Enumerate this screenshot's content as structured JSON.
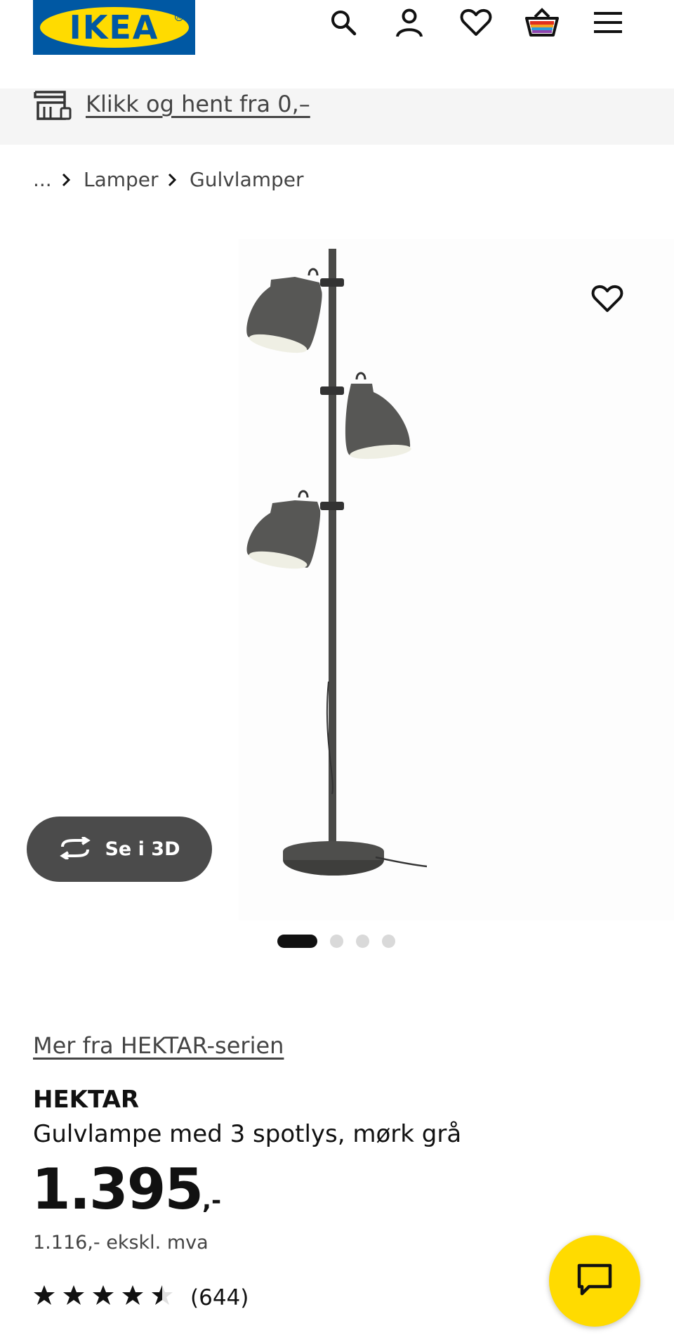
{
  "header": {
    "logo_text": "IKEA",
    "icons": [
      "search-icon",
      "user-icon",
      "heart-icon",
      "cart-icon",
      "menu-icon"
    ]
  },
  "banner": {
    "icon": "store-icon",
    "link_text": "Klikk og hent fra 0,–"
  },
  "breadcrumb": {
    "ellipsis": "...",
    "items": [
      "Lamper",
      "Gulvlamper"
    ]
  },
  "gallery": {
    "view_3d_label": "Se i 3D",
    "slide_count": 4,
    "active_slide": 1
  },
  "product": {
    "series_link": "Mer fra HEKTAR-serien",
    "name": "HEKTAR",
    "description": "Gulvlampe med 3 spotlys, mørk grå",
    "price_integer": "1.395",
    "price_suffix": ",-",
    "price_ex_vat": "1.116,- ekskl. mva",
    "rating": 4.5,
    "rating_max": 5,
    "review_count": "(644)"
  },
  "colors": {
    "brand_blue": "#0058a3",
    "brand_yellow": "#ffdb00"
  }
}
